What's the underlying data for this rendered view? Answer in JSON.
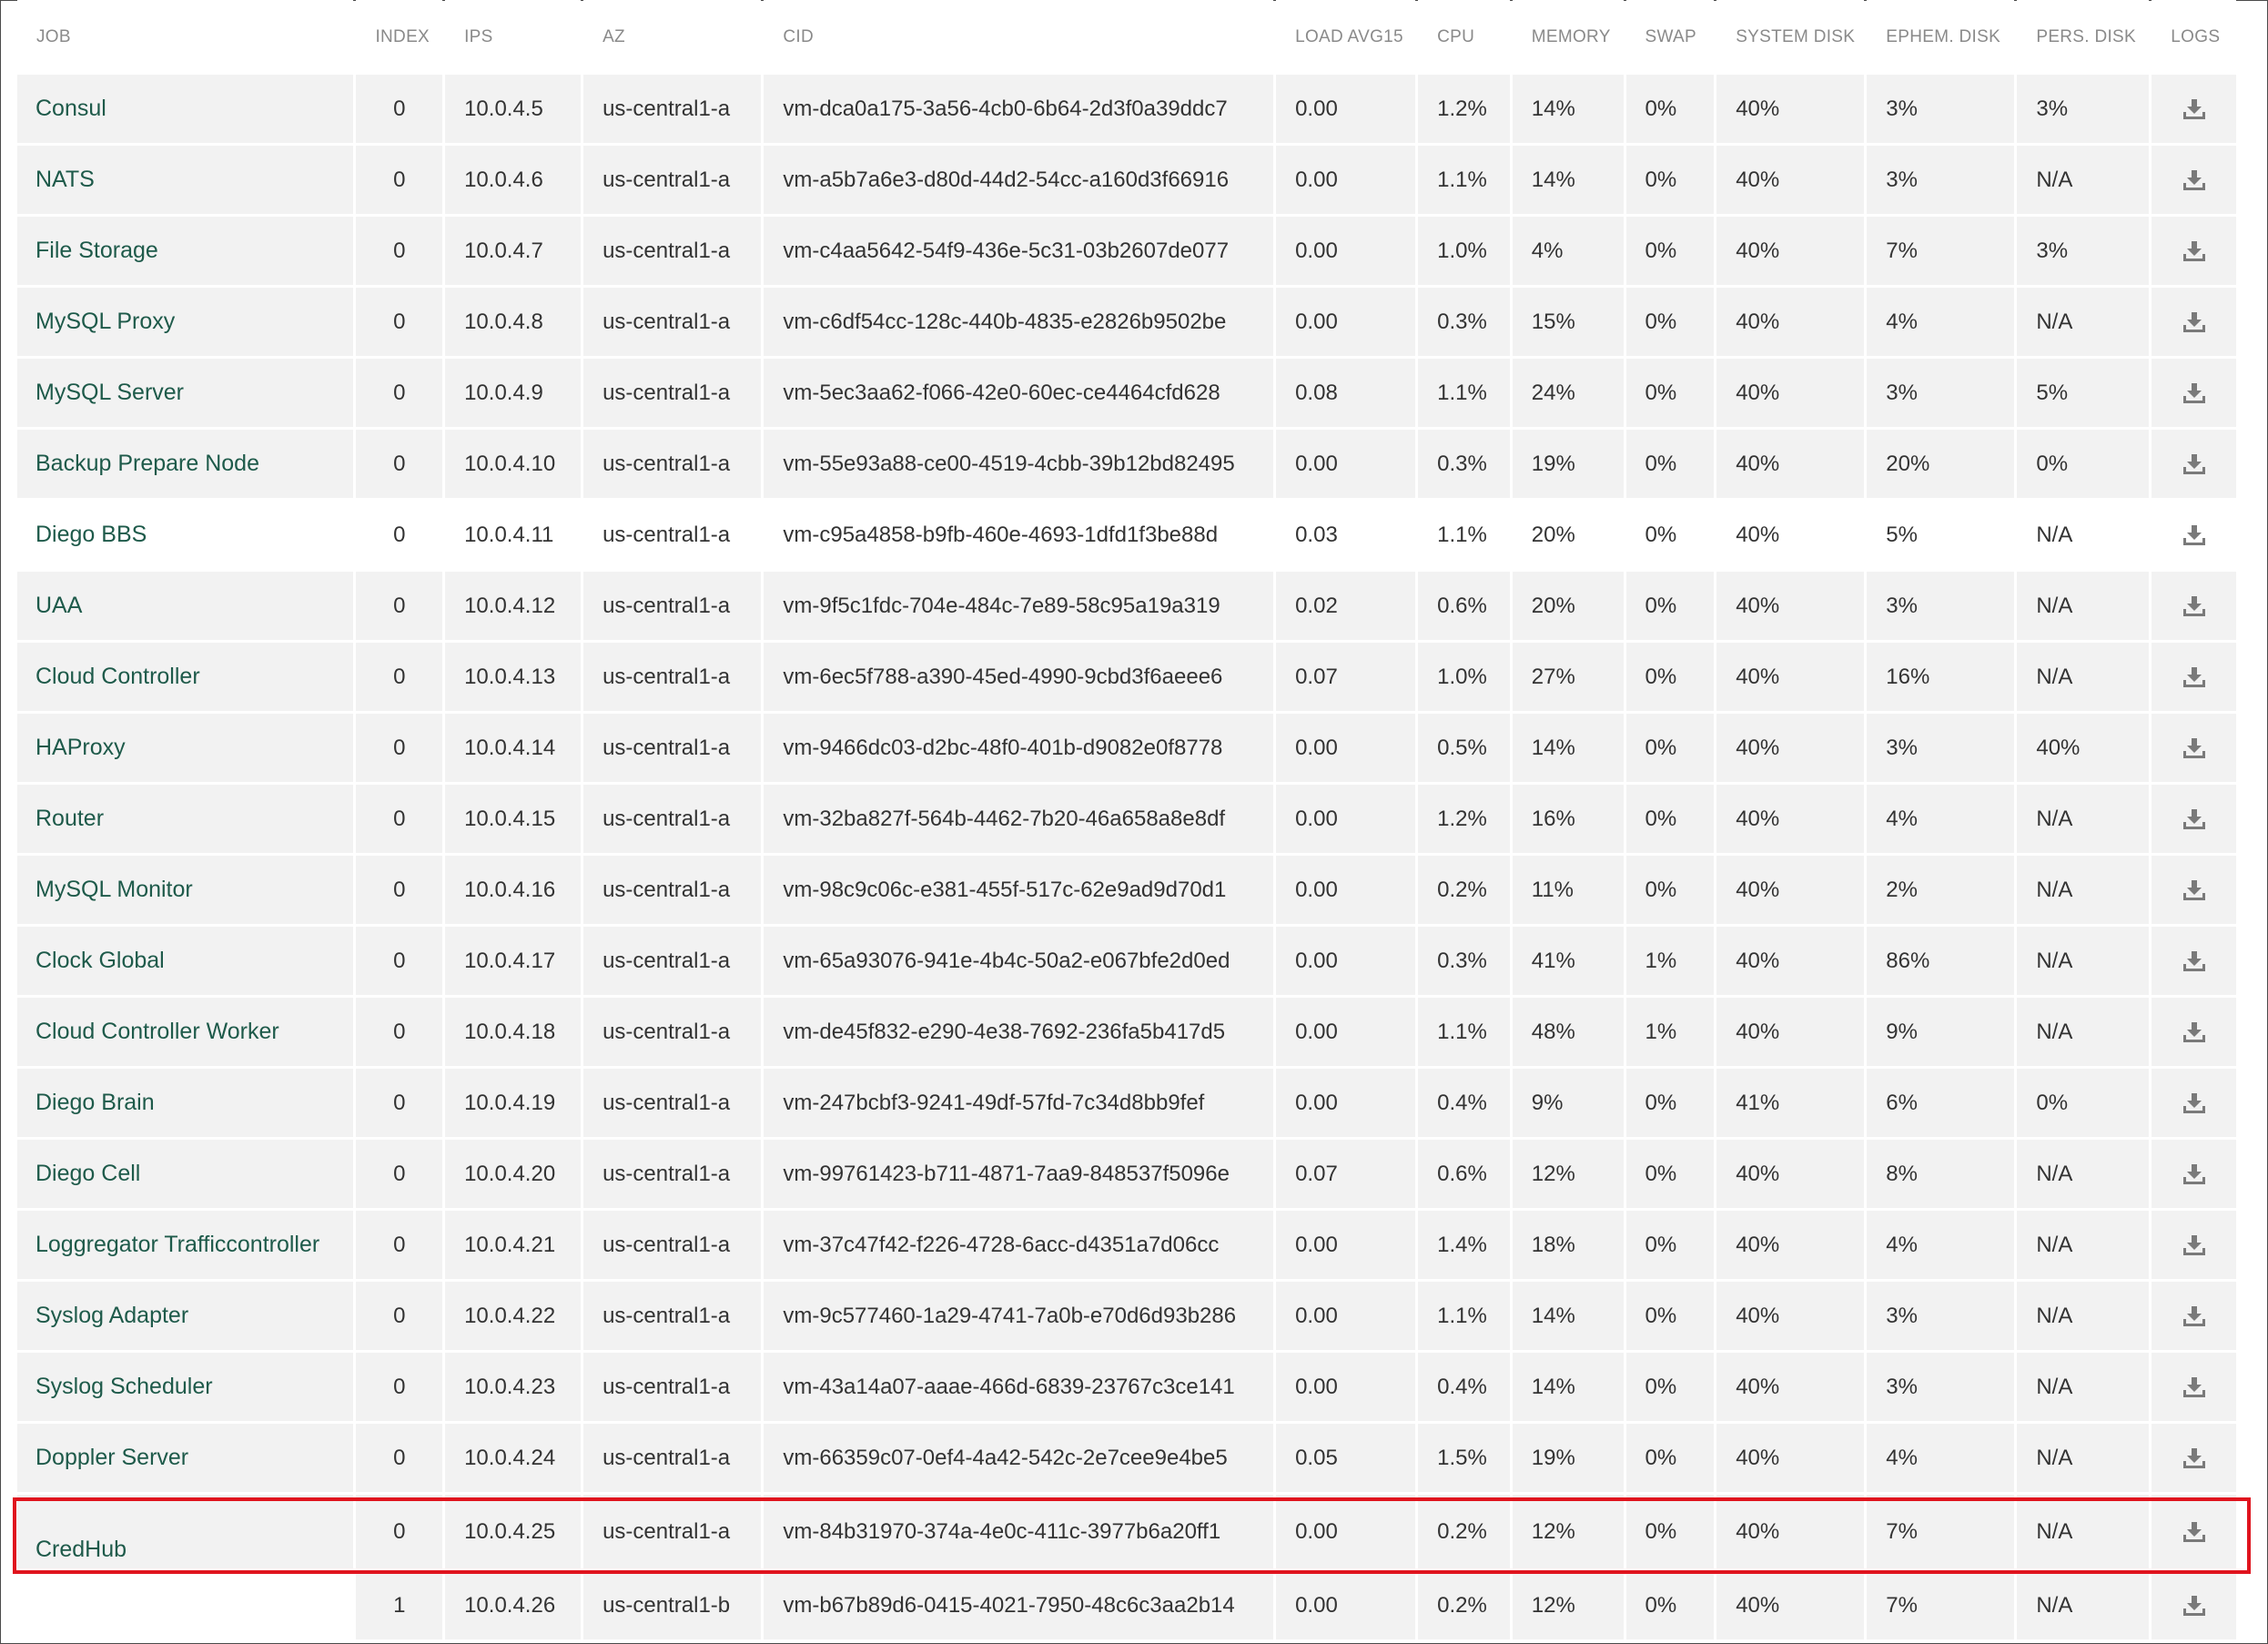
{
  "columns": [
    "JOB",
    "INDEX",
    "IPS",
    "AZ",
    "CID",
    "LOAD AVG15",
    "CPU",
    "MEMORY",
    "SWAP",
    "SYSTEM DISK",
    "EPHEM. DISK",
    "PERS. DISK",
    "LOGS"
  ],
  "rows": [
    {
      "job": "Consul",
      "index": "0",
      "ips": "10.0.4.5",
      "az": "us-central1-a",
      "cid": "vm-dca0a175-3a56-4cb0-6b64-2d3f0a39ddc7",
      "load": "0.00",
      "cpu": "1.2%",
      "memory": "14%",
      "swap": "0%",
      "sysdisk": "40%",
      "ephem": "3%",
      "pers": "3%"
    },
    {
      "job": "NATS",
      "index": "0",
      "ips": "10.0.4.6",
      "az": "us-central1-a",
      "cid": "vm-a5b7a6e3-d80d-44d2-54cc-a160d3f66916",
      "load": "0.00",
      "cpu": "1.1%",
      "memory": "14%",
      "swap": "0%",
      "sysdisk": "40%",
      "ephem": "3%",
      "pers": "N/A"
    },
    {
      "job": "File Storage",
      "index": "0",
      "ips": "10.0.4.7",
      "az": "us-central1-a",
      "cid": "vm-c4aa5642-54f9-436e-5c31-03b2607de077",
      "load": "0.00",
      "cpu": "1.0%",
      "memory": "4%",
      "swap": "0%",
      "sysdisk": "40%",
      "ephem": "7%",
      "pers": "3%"
    },
    {
      "job": "MySQL Proxy",
      "index": "0",
      "ips": "10.0.4.8",
      "az": "us-central1-a",
      "cid": "vm-c6df54cc-128c-440b-4835-e2826b9502be",
      "load": "0.00",
      "cpu": "0.3%",
      "memory": "15%",
      "swap": "0%",
      "sysdisk": "40%",
      "ephem": "4%",
      "pers": "N/A"
    },
    {
      "job": "MySQL Server",
      "index": "0",
      "ips": "10.0.4.9",
      "az": "us-central1-a",
      "cid": "vm-5ec3aa62-f066-42e0-60ec-ce4464cfd628",
      "load": "0.08",
      "cpu": "1.1%",
      "memory": "24%",
      "swap": "0%",
      "sysdisk": "40%",
      "ephem": "3%",
      "pers": "5%"
    },
    {
      "job": "Backup Prepare Node",
      "index": "0",
      "ips": "10.0.4.10",
      "az": "us-central1-a",
      "cid": "vm-55e93a88-ce00-4519-4cbb-39b12bd82495",
      "load": "0.00",
      "cpu": "0.3%",
      "memory": "19%",
      "swap": "0%",
      "sysdisk": "40%",
      "ephem": "20%",
      "pers": "0%"
    },
    {
      "job": "Diego BBS",
      "index": "0",
      "ips": "10.0.4.11",
      "az": "us-central1-a",
      "cid": "vm-c95a4858-b9fb-460e-4693-1dfd1f3be88d",
      "load": "0.03",
      "cpu": "1.1%",
      "memory": "20%",
      "swap": "0%",
      "sysdisk": "40%",
      "ephem": "5%",
      "pers": "N/A",
      "highlighted": true
    },
    {
      "job": "UAA",
      "index": "0",
      "ips": "10.0.4.12",
      "az": "us-central1-a",
      "cid": "vm-9f5c1fdc-704e-484c-7e89-58c95a19a319",
      "load": "0.02",
      "cpu": "0.6%",
      "memory": "20%",
      "swap": "0%",
      "sysdisk": "40%",
      "ephem": "3%",
      "pers": "N/A"
    },
    {
      "job": "Cloud Controller",
      "index": "0",
      "ips": "10.0.4.13",
      "az": "us-central1-a",
      "cid": "vm-6ec5f788-a390-45ed-4990-9cbd3f6aeee6",
      "load": "0.07",
      "cpu": "1.0%",
      "memory": "27%",
      "swap": "0%",
      "sysdisk": "40%",
      "ephem": "16%",
      "pers": "N/A"
    },
    {
      "job": "HAProxy",
      "index": "0",
      "ips": "10.0.4.14",
      "az": "us-central1-a",
      "cid": "vm-9466dc03-d2bc-48f0-401b-d9082e0f8778",
      "load": "0.00",
      "cpu": "0.5%",
      "memory": "14%",
      "swap": "0%",
      "sysdisk": "40%",
      "ephem": "3%",
      "pers": "40%"
    },
    {
      "job": "Router",
      "index": "0",
      "ips": "10.0.4.15",
      "az": "us-central1-a",
      "cid": "vm-32ba827f-564b-4462-7b20-46a658a8e8df",
      "load": "0.00",
      "cpu": "1.2%",
      "memory": "16%",
      "swap": "0%",
      "sysdisk": "40%",
      "ephem": "4%",
      "pers": "N/A"
    },
    {
      "job": "MySQL Monitor",
      "index": "0",
      "ips": "10.0.4.16",
      "az": "us-central1-a",
      "cid": "vm-98c9c06c-e381-455f-517c-62e9ad9d70d1",
      "load": "0.00",
      "cpu": "0.2%",
      "memory": "11%",
      "swap": "0%",
      "sysdisk": "40%",
      "ephem": "2%",
      "pers": "N/A"
    },
    {
      "job": "Clock Global",
      "index": "0",
      "ips": "10.0.4.17",
      "az": "us-central1-a",
      "cid": "vm-65a93076-941e-4b4c-50a2-e067bfe2d0ed",
      "load": "0.00",
      "cpu": "0.3%",
      "memory": "41%",
      "swap": "1%",
      "sysdisk": "40%",
      "ephem": "86%",
      "pers": "N/A"
    },
    {
      "job": "Cloud Controller Worker",
      "index": "0",
      "ips": "10.0.4.18",
      "az": "us-central1-a",
      "cid": "vm-de45f832-e290-4e38-7692-236fa5b417d5",
      "load": "0.00",
      "cpu": "1.1%",
      "memory": "48%",
      "swap": "1%",
      "sysdisk": "40%",
      "ephem": "9%",
      "pers": "N/A"
    },
    {
      "job": "Diego Brain",
      "index": "0",
      "ips": "10.0.4.19",
      "az": "us-central1-a",
      "cid": "vm-247bcbf3-9241-49df-57fd-7c34d8bb9fef",
      "load": "0.00",
      "cpu": "0.4%",
      "memory": "9%",
      "swap": "0%",
      "sysdisk": "41%",
      "ephem": "6%",
      "pers": "0%"
    },
    {
      "job": "Diego Cell",
      "index": "0",
      "ips": "10.0.4.20",
      "az": "us-central1-a",
      "cid": "vm-99761423-b711-4871-7aa9-848537f5096e",
      "load": "0.07",
      "cpu": "0.6%",
      "memory": "12%",
      "swap": "0%",
      "sysdisk": "40%",
      "ephem": "8%",
      "pers": "N/A"
    },
    {
      "job": "Loggregator Trafficcontroller",
      "index": "0",
      "ips": "10.0.4.21",
      "az": "us-central1-a",
      "cid": "vm-37c47f42-f226-4728-6acc-d4351a7d06cc",
      "load": "0.00",
      "cpu": "1.4%",
      "memory": "18%",
      "swap": "0%",
      "sysdisk": "40%",
      "ephem": "4%",
      "pers": "N/A"
    },
    {
      "job": "Syslog Adapter",
      "index": "0",
      "ips": "10.0.4.22",
      "az": "us-central1-a",
      "cid": "vm-9c577460-1a29-4741-7a0b-e70d6d93b286",
      "load": "0.00",
      "cpu": "1.1%",
      "memory": "14%",
      "swap": "0%",
      "sysdisk": "40%",
      "ephem": "3%",
      "pers": "N/A"
    },
    {
      "job": "Syslog Scheduler",
      "index": "0",
      "ips": "10.0.4.23",
      "az": "us-central1-a",
      "cid": "vm-43a14a07-aaae-466d-6839-23767c3ce141",
      "load": "0.00",
      "cpu": "0.4%",
      "memory": "14%",
      "swap": "0%",
      "sysdisk": "40%",
      "ephem": "3%",
      "pers": "N/A"
    },
    {
      "job": "Doppler Server",
      "index": "0",
      "ips": "10.0.4.24",
      "az": "us-central1-a",
      "cid": "vm-66359c07-0ef4-4a42-542c-2e7cee9e4be5",
      "load": "0.05",
      "cpu": "1.5%",
      "memory": "19%",
      "swap": "0%",
      "sysdisk": "40%",
      "ephem": "4%",
      "pers": "N/A"
    }
  ],
  "credhub": {
    "job": "CredHub",
    "instances": [
      {
        "index": "0",
        "ips": "10.0.4.25",
        "az": "us-central1-a",
        "cid": "vm-84b31970-374a-4e0c-411c-3977b6a20ff1",
        "load": "0.00",
        "cpu": "0.2%",
        "memory": "12%",
        "swap": "0%",
        "sysdisk": "40%",
        "ephem": "7%",
        "pers": "N/A"
      },
      {
        "index": "1",
        "ips": "10.0.4.26",
        "az": "us-central1-b",
        "cid": "vm-b67b89d6-0415-4021-7950-48c6c3aa2b14",
        "load": "0.00",
        "cpu": "0.2%",
        "memory": "12%",
        "swap": "0%",
        "sysdisk": "40%",
        "ephem": "7%",
        "pers": "N/A"
      }
    ]
  },
  "icons": {
    "logs": "download-icon"
  },
  "colors": {
    "job_link": "#1e5a4a",
    "row_bg": "#f2f2f2",
    "header_text": "#8a8a8a",
    "highlight_border": "#e0141e"
  }
}
